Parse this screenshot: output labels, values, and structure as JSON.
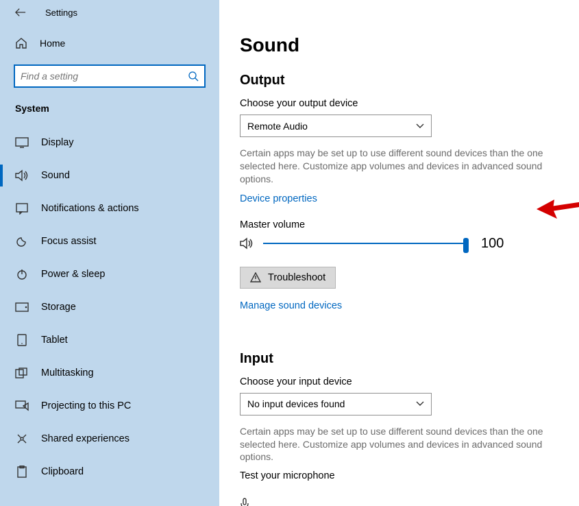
{
  "app": {
    "title": "Settings"
  },
  "sidebar": {
    "home": "Home",
    "search_placeholder": "Find a setting",
    "category": "System",
    "items": [
      {
        "label": "Display"
      },
      {
        "label": "Sound"
      },
      {
        "label": "Notifications & actions"
      },
      {
        "label": "Focus assist"
      },
      {
        "label": "Power & sleep"
      },
      {
        "label": "Storage"
      },
      {
        "label": "Tablet"
      },
      {
        "label": "Multitasking"
      },
      {
        "label": "Projecting to this PC"
      },
      {
        "label": "Shared experiences"
      },
      {
        "label": "Clipboard"
      }
    ]
  },
  "main": {
    "title": "Sound",
    "output": {
      "header": "Output",
      "choose_label": "Choose your output device",
      "selected_device": "Remote Audio",
      "helper": "Certain apps may be set up to use different sound devices than the one selected here. Customize app volumes and devices in advanced sound options.",
      "device_properties": "Device properties",
      "master_volume_label": "Master volume",
      "master_volume_value": "100",
      "troubleshoot": "Troubleshoot",
      "manage_devices": "Manage sound devices"
    },
    "input": {
      "header": "Input",
      "choose_label": "Choose your input device",
      "selected_device": "No input devices found",
      "helper": "Certain apps may be set up to use different sound devices than the one selected here. Customize app volumes and devices in advanced sound options.",
      "test_mic": "Test your microphone"
    }
  }
}
